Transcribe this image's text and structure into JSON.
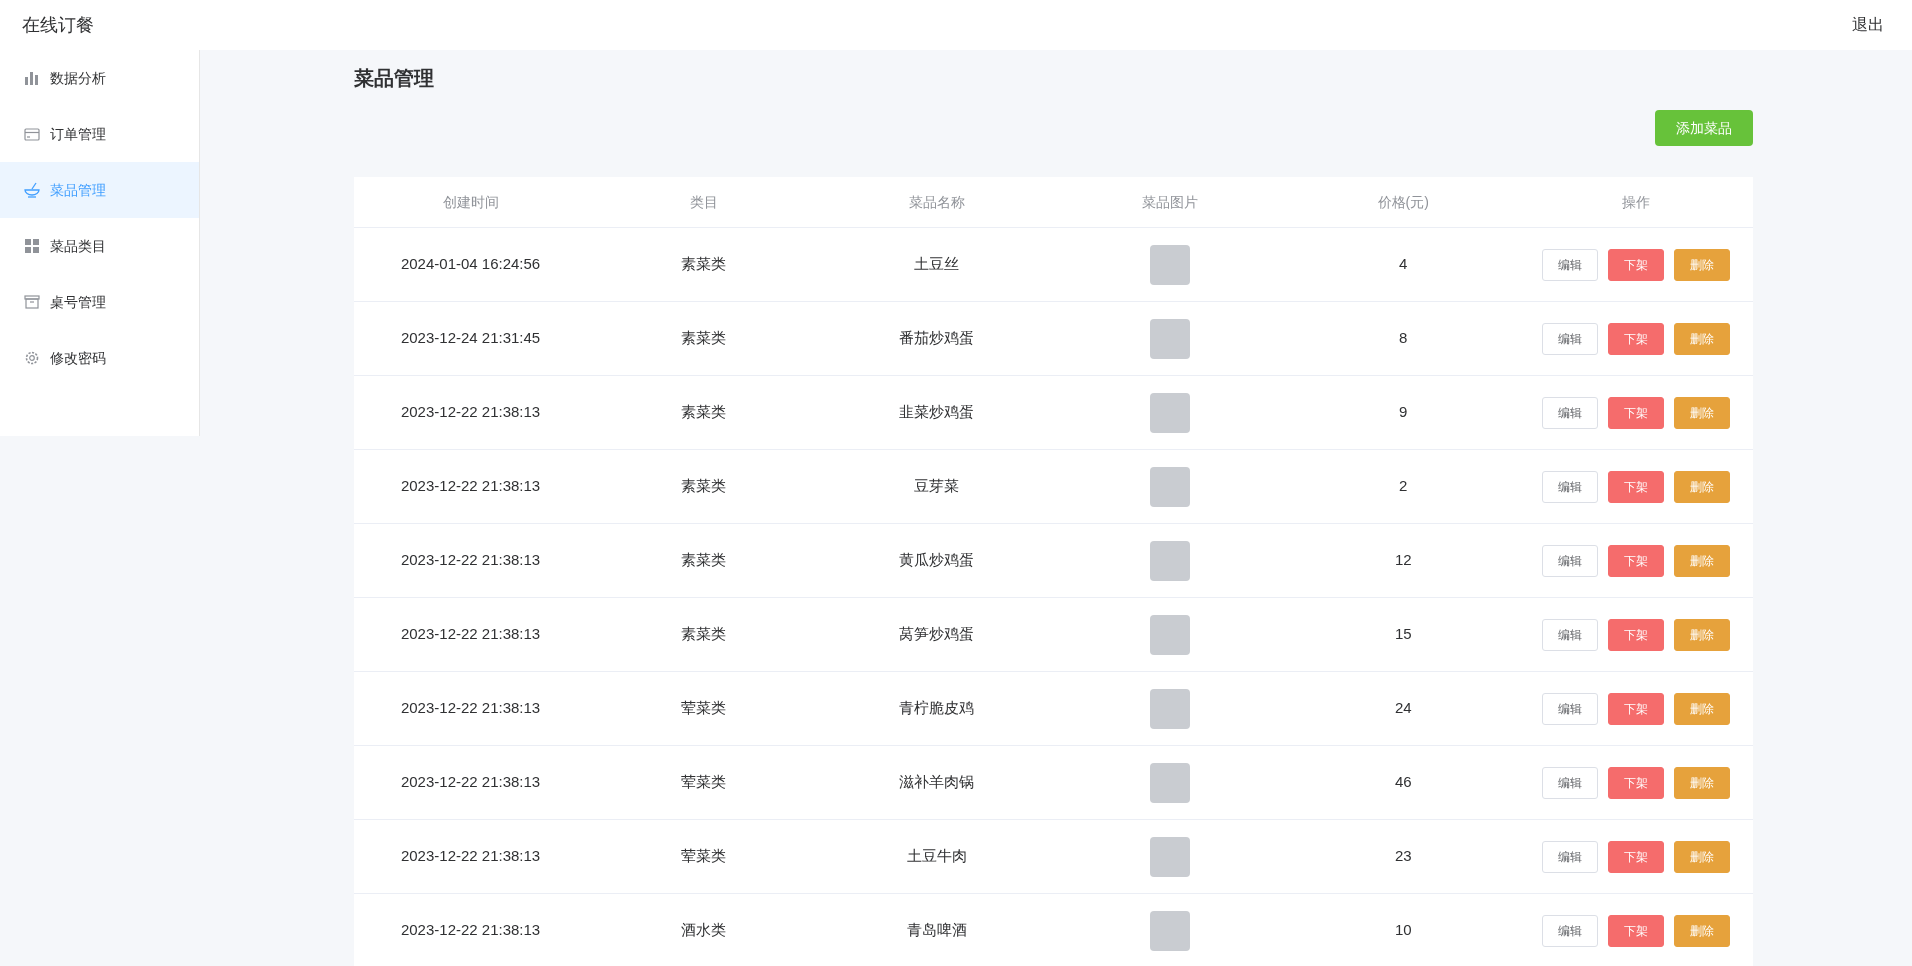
{
  "header": {
    "title": "在线订餐",
    "logout": "退出"
  },
  "sidebar": {
    "items": [
      {
        "label": "数据分析",
        "selected": false
      },
      {
        "label": "订单管理",
        "selected": false
      },
      {
        "label": "菜品管理",
        "selected": true
      },
      {
        "label": "菜品类目",
        "selected": false
      },
      {
        "label": "桌号管理",
        "selected": false
      },
      {
        "label": "修改密码",
        "selected": false
      }
    ]
  },
  "page": {
    "title": "菜品管理",
    "add_button": "添加菜品"
  },
  "table": {
    "columns": [
      "创建时间",
      "类目",
      "菜品名称",
      "菜品图片",
      "价格(元)",
      "操作"
    ],
    "rows": [
      {
        "created": "2024-01-04 16:24:56",
        "category": "素菜类",
        "name": "土豆丝",
        "price": "4",
        "actions": [
          {
            "label": "编辑",
            "kind": "plain"
          },
          {
            "label": "下架",
            "kind": "danger"
          },
          {
            "label": "删除",
            "kind": "warning"
          }
        ]
      },
      {
        "created": "2023-12-24 21:31:45",
        "category": "素菜类",
        "name": "番茄炒鸡蛋",
        "price": "8",
        "actions": [
          {
            "label": "编辑",
            "kind": "plain"
          },
          {
            "label": "下架",
            "kind": "danger"
          },
          {
            "label": "删除",
            "kind": "warning"
          }
        ]
      },
      {
        "created": "2023-12-22 21:38:13",
        "category": "素菜类",
        "name": "韭菜炒鸡蛋",
        "price": "9",
        "actions": [
          {
            "label": "编辑",
            "kind": "plain"
          },
          {
            "label": "下架",
            "kind": "danger"
          },
          {
            "label": "删除",
            "kind": "warning"
          }
        ]
      },
      {
        "created": "2023-12-22 21:38:13",
        "category": "素菜类",
        "name": "豆芽菜",
        "price": "2",
        "actions": [
          {
            "label": "编辑",
            "kind": "plain"
          },
          {
            "label": "下架",
            "kind": "danger"
          },
          {
            "label": "删除",
            "kind": "warning"
          }
        ]
      },
      {
        "created": "2023-12-22 21:38:13",
        "category": "素菜类",
        "name": "黄瓜炒鸡蛋",
        "price": "12",
        "actions": [
          {
            "label": "编辑",
            "kind": "plain"
          },
          {
            "label": "下架",
            "kind": "danger"
          },
          {
            "label": "删除",
            "kind": "warning"
          }
        ]
      },
      {
        "created": "2023-12-22 21:38:13",
        "category": "素菜类",
        "name": "莴笋炒鸡蛋",
        "price": "15",
        "actions": [
          {
            "label": "编辑",
            "kind": "plain"
          },
          {
            "label": "下架",
            "kind": "danger"
          },
          {
            "label": "删除",
            "kind": "warning"
          }
        ]
      },
      {
        "created": "2023-12-22 21:38:13",
        "category": "荤菜类",
        "name": "青柠脆皮鸡",
        "price": "24",
        "actions": [
          {
            "label": "编辑",
            "kind": "plain"
          },
          {
            "label": "下架",
            "kind": "danger"
          },
          {
            "label": "删除",
            "kind": "warning"
          }
        ]
      },
      {
        "created": "2023-12-22 21:38:13",
        "category": "荤菜类",
        "name": "滋补羊肉锅",
        "price": "46",
        "actions": [
          {
            "label": "编辑",
            "kind": "plain"
          },
          {
            "label": "下架",
            "kind": "danger"
          },
          {
            "label": "删除",
            "kind": "warning"
          }
        ]
      },
      {
        "created": "2023-12-22 21:38:13",
        "category": "荤菜类",
        "name": "土豆牛肉",
        "price": "23",
        "actions": [
          {
            "label": "编辑",
            "kind": "plain"
          },
          {
            "label": "下架",
            "kind": "danger"
          },
          {
            "label": "删除",
            "kind": "warning"
          }
        ]
      },
      {
        "created": "2023-12-22 21:38:13",
        "category": "酒水类",
        "name": "青岛啤酒",
        "price": "10",
        "actions": [
          {
            "label": "编辑",
            "kind": "plain"
          },
          {
            "label": "下架",
            "kind": "danger"
          },
          {
            "label": "删除",
            "kind": "warning"
          }
        ]
      }
    ]
  }
}
